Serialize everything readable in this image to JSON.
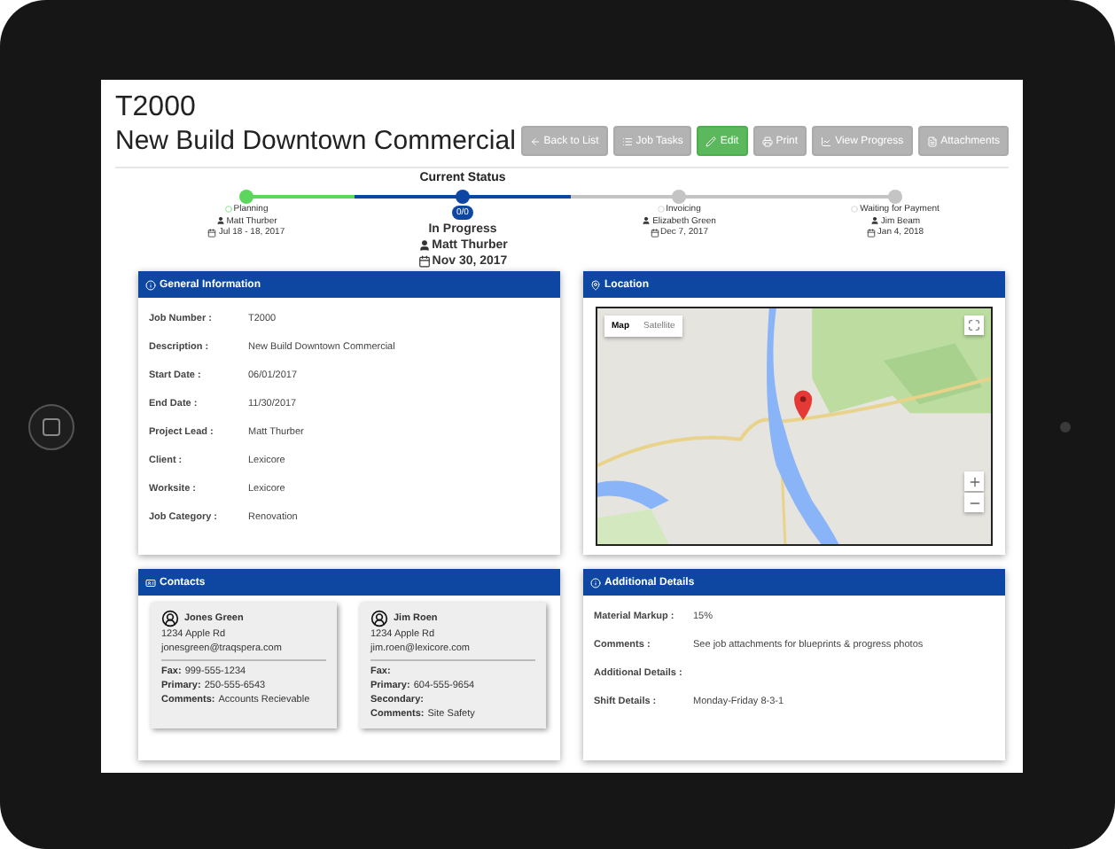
{
  "header": {
    "job_number": "T2000",
    "title": "New Build Downtown Commercial"
  },
  "actions": [
    {
      "label": "Back to List",
      "kind": "back"
    },
    {
      "label": "Job Tasks",
      "kind": "tasks"
    },
    {
      "label": "Edit",
      "kind": "edit"
    },
    {
      "label": "Print",
      "kind": "print"
    },
    {
      "label": "View Progress",
      "kind": "progress"
    },
    {
      "label": "Attachments",
      "kind": "attachments"
    }
  ],
  "progress": {
    "heading": "Current Status",
    "steps": [
      {
        "label": "Planning",
        "person": "Matt Thurber",
        "date": "Jul 18 - 18, 2017",
        "completed": true,
        "selected": false
      },
      {
        "label": "In Progress",
        "count": "0/0",
        "person": "Matt Thurber",
        "date": "Nov 30, 2017",
        "completed": false,
        "selected": true
      },
      {
        "label": "Invoicing",
        "person": "Elizabeth Green",
        "date": "Dec 7, 2017",
        "completed": false,
        "selected": false
      },
      {
        "label": "Waiting for Payment",
        "person": "Jim Beam",
        "date": "Jan 4, 2018",
        "completed": false,
        "selected": false
      }
    ]
  },
  "general_information": {
    "title": "General Information",
    "fields": [
      {
        "label": "Job Number :",
        "value": "T2000"
      },
      {
        "label": "Description :",
        "value": "New Build Downtown Commercial"
      },
      {
        "label": "Start Date :",
        "value": "06/01/2017"
      },
      {
        "label": "End Date :",
        "value": "11/30/2017"
      },
      {
        "label": "Project Lead :",
        "value": "Matt Thurber"
      },
      {
        "label": "Client :",
        "value": "Lexicore"
      },
      {
        "label": "Worksite :",
        "value": "Lexicore"
      },
      {
        "label": "Job Category :",
        "value": "Renovation"
      }
    ]
  },
  "location": {
    "title": "Location",
    "map_types": [
      {
        "label": "Map",
        "selected": true
      },
      {
        "label": "Satellite",
        "selected": false
      }
    ]
  },
  "contacts": {
    "title": "Contacts",
    "cards": [
      {
        "name": "Jones Green",
        "address": "1234 Apple Rd",
        "email": "jonesgreen@traqspera.com",
        "details": [
          {
            "label": "Fax:",
            "value": "999-555-1234"
          },
          {
            "label": "Primary:",
            "value": "250-555-6543"
          },
          {
            "label": "Comments:",
            "value": "Accounts Recievable"
          }
        ]
      },
      {
        "name": "Jim Roen",
        "address": "1234 Apple Rd",
        "email": "jim.roen@lexicore.com",
        "details": [
          {
            "label": "Fax:"
          },
          {
            "label": "Primary:",
            "value": "604-555-9654"
          },
          {
            "label": "Secondary:"
          },
          {
            "label": "Comments:",
            "value": "Site Safety"
          }
        ]
      }
    ]
  },
  "additional_details": {
    "title": "Additional Details",
    "fields": [
      {
        "label": "Material Markup :",
        "value": "15%"
      },
      {
        "label": "Comments :",
        "value": "See job attachments for blueprints & progress photos"
      },
      {
        "label": "Additional Details :"
      },
      {
        "label": "Shift Details :",
        "value": "Monday-Friday 8-3-1"
      }
    ]
  }
}
